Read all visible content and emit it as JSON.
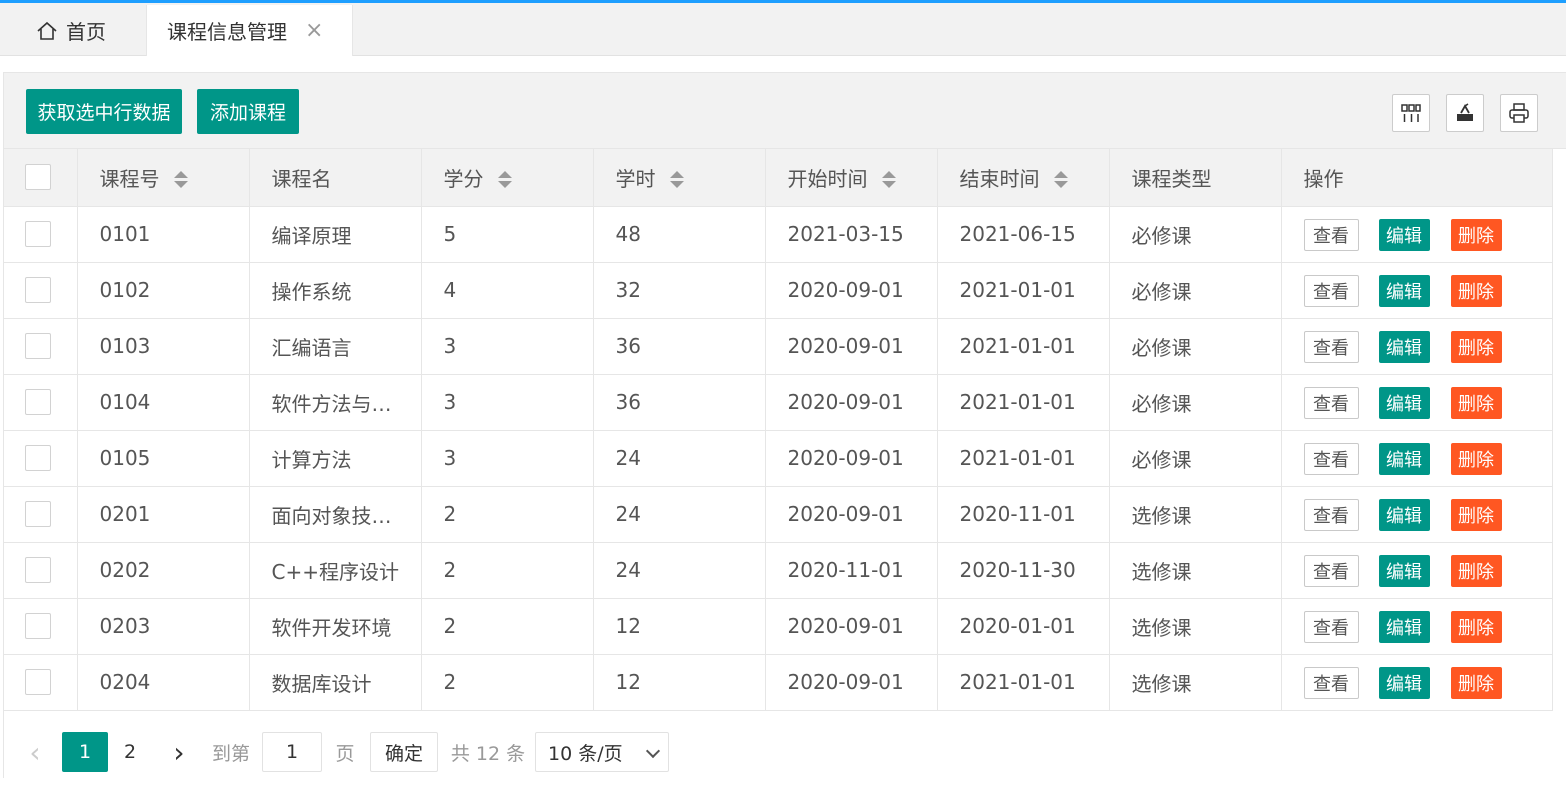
{
  "tabs": [
    {
      "label": "首页",
      "icon": "home-icon"
    },
    {
      "label": "课程信息管理",
      "closable": true
    }
  ],
  "toolbar": {
    "get_selected_label": "获取选中行数据",
    "add_course_label": "添加课程",
    "icons": [
      "columns-filter-icon",
      "export-icon",
      "print-icon"
    ]
  },
  "table": {
    "headers": [
      "课程号",
      "课程名",
      "学分",
      "学时",
      "开始时间",
      "结束时间",
      "课程类型",
      "操作"
    ],
    "rows": [
      {
        "id": "0101",
        "name": "编译原理",
        "credit": "5",
        "hours": "48",
        "start": "2021-03-15",
        "end": "2021-06-15",
        "type": "必修课"
      },
      {
        "id": "0102",
        "name": "操作系统",
        "credit": "4",
        "hours": "32",
        "start": "2020-09-01",
        "end": "2021-01-01",
        "type": "必修课"
      },
      {
        "id": "0103",
        "name": "汇编语言",
        "credit": "3",
        "hours": "36",
        "start": "2020-09-01",
        "end": "2021-01-01",
        "type": "必修课"
      },
      {
        "id": "0104",
        "name": "软件方法与…",
        "credit": "3",
        "hours": "36",
        "start": "2020-09-01",
        "end": "2021-01-01",
        "type": "必修课"
      },
      {
        "id": "0105",
        "name": "计算方法",
        "credit": "3",
        "hours": "24",
        "start": "2020-09-01",
        "end": "2021-01-01",
        "type": "必修课"
      },
      {
        "id": "0201",
        "name": "面向对象技…",
        "credit": "2",
        "hours": "24",
        "start": "2020-09-01",
        "end": "2020-11-01",
        "type": "选修课"
      },
      {
        "id": "0202",
        "name": "C++程序设计",
        "credit": "2",
        "hours": "24",
        "start": "2020-11-01",
        "end": "2020-11-30",
        "type": "选修课"
      },
      {
        "id": "0203",
        "name": "软件开发环境",
        "credit": "2",
        "hours": "12",
        "start": "2020-09-01",
        "end": "2020-01-01",
        "type": "选修课"
      },
      {
        "id": "0204",
        "name": "数据库设计",
        "credit": "2",
        "hours": "12",
        "start": "2020-09-01",
        "end": "2021-01-01",
        "type": "选修课"
      }
    ],
    "actions": {
      "view": "查看",
      "edit": "编辑",
      "delete": "删除"
    }
  },
  "pager": {
    "prev": "‹",
    "pages": [
      "1",
      "2"
    ],
    "current": "1",
    "next": "›",
    "goto_label": "到第",
    "goto_value": "1",
    "page_unit": "页",
    "confirm": "确定",
    "total": "共 12 条",
    "page_size": "10 条/页"
  },
  "colors": {
    "primary": "#009688",
    "danger": "#ff5722",
    "accent_top": "#1e9fff"
  }
}
